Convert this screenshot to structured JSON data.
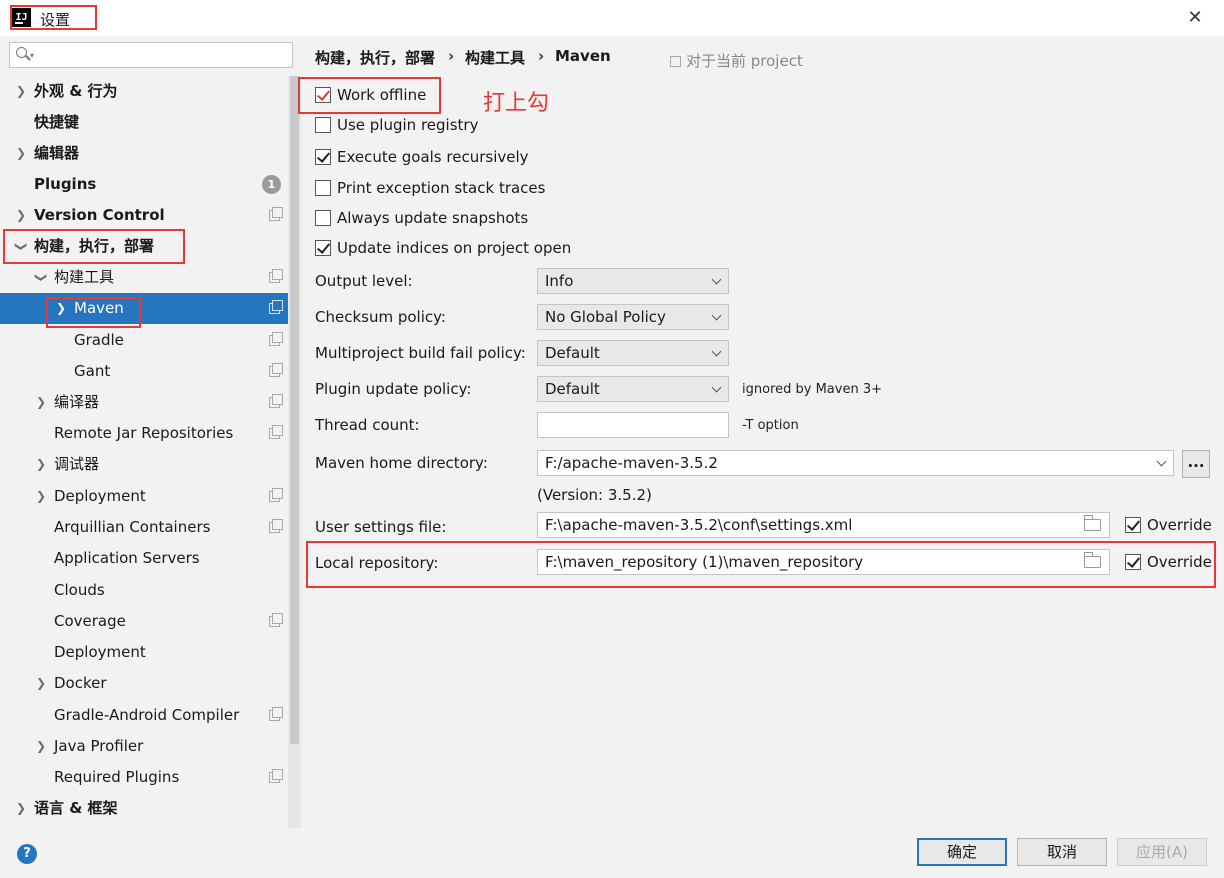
{
  "window": {
    "title": "设置",
    "app_icon_text": "IJ"
  },
  "search": {
    "placeholder": ""
  },
  "tree": [
    {
      "label": "外观 & 行为",
      "expandable": true,
      "expanded": false,
      "bold": true
    },
    {
      "label": "快捷键",
      "expandable": false,
      "bold": true
    },
    {
      "label": "编辑器",
      "expandable": true,
      "expanded": false,
      "bold": true
    },
    {
      "label": "Plugins",
      "expandable": false,
      "bold": true,
      "badge": "1"
    },
    {
      "label": "Version Control",
      "expandable": true,
      "expanded": false,
      "bold": true
    },
    {
      "label": "构建，执行，部署",
      "expandable": true,
      "expanded": true,
      "bold": true
    },
    {
      "label": "构建工具",
      "expandable": true,
      "expanded": true
    },
    {
      "label": "Maven",
      "expandable": true,
      "expanded": false,
      "selected": true
    },
    {
      "label": "Gradle"
    },
    {
      "label": "Gant"
    },
    {
      "label": "编译器",
      "expandable": true
    },
    {
      "label": "Remote Jar Repositories"
    },
    {
      "label": "调试器",
      "expandable": true
    },
    {
      "label": "Deployment",
      "expandable": true
    },
    {
      "label": "Arquillian Containers"
    },
    {
      "label": "Application Servers"
    },
    {
      "label": "Clouds"
    },
    {
      "label": "Coverage"
    },
    {
      "label": "Deployment"
    },
    {
      "label": "Docker",
      "expandable": true
    },
    {
      "label": "Gradle-Android Compiler"
    },
    {
      "label": "Java Profiler",
      "expandable": true
    },
    {
      "label": "Required Plugins"
    },
    {
      "label": "语言 & 框架",
      "expandable": true,
      "bold": true
    }
  ],
  "breadcrumb": {
    "part1": "构建，执行，部署",
    "part2": "构建工具",
    "part3": "Maven",
    "sep": "›"
  },
  "scope_note": "对于当前 project",
  "annotation": "打上勾",
  "checkboxes": {
    "work_offline": {
      "label": "Work offline",
      "checked": true
    },
    "use_plugin_registry": {
      "label": "Use plugin registry",
      "checked": false
    },
    "execute_goals": {
      "label": "Execute goals recursively",
      "checked": true
    },
    "print_exception": {
      "label": "Print exception stack traces",
      "checked": false
    },
    "always_update": {
      "label": "Always update snapshots",
      "checked": false
    },
    "update_indices": {
      "label": "Update indices on project open",
      "checked": true
    }
  },
  "fields": {
    "output_level": {
      "label": "Output level:",
      "value": "Info"
    },
    "checksum_policy": {
      "label": "Checksum policy:",
      "value": "No Global Policy"
    },
    "multiproject_policy": {
      "label": "Multiproject build fail policy:",
      "value": "Default"
    },
    "plugin_update_policy": {
      "label": "Plugin update policy:",
      "value": "Default",
      "hint": "ignored by Maven 3+"
    },
    "thread_count": {
      "label": "Thread count:",
      "value": "",
      "hint": "-T option"
    },
    "maven_home": {
      "label": "Maven home directory:",
      "value": "F:/apache-maven-3.5.2",
      "version": "(Version: 3.5.2)",
      "browse": "..."
    },
    "user_settings": {
      "label": "User settings file:",
      "value": "F:\\apache-maven-3.5.2\\conf\\settings.xml",
      "override_label": "Override",
      "override": true
    },
    "local_repo": {
      "label": "Local repository:",
      "value": "F:\\maven_repository (1)\\maven_repository",
      "override_label": "Override",
      "override": true
    }
  },
  "buttons": {
    "ok": "确定",
    "cancel": "取消",
    "apply": "应用(A)",
    "help": "?"
  },
  "colors": {
    "accent": "#2675bf",
    "annotation_red": "#e53935",
    "background": "#f2f2f2"
  }
}
